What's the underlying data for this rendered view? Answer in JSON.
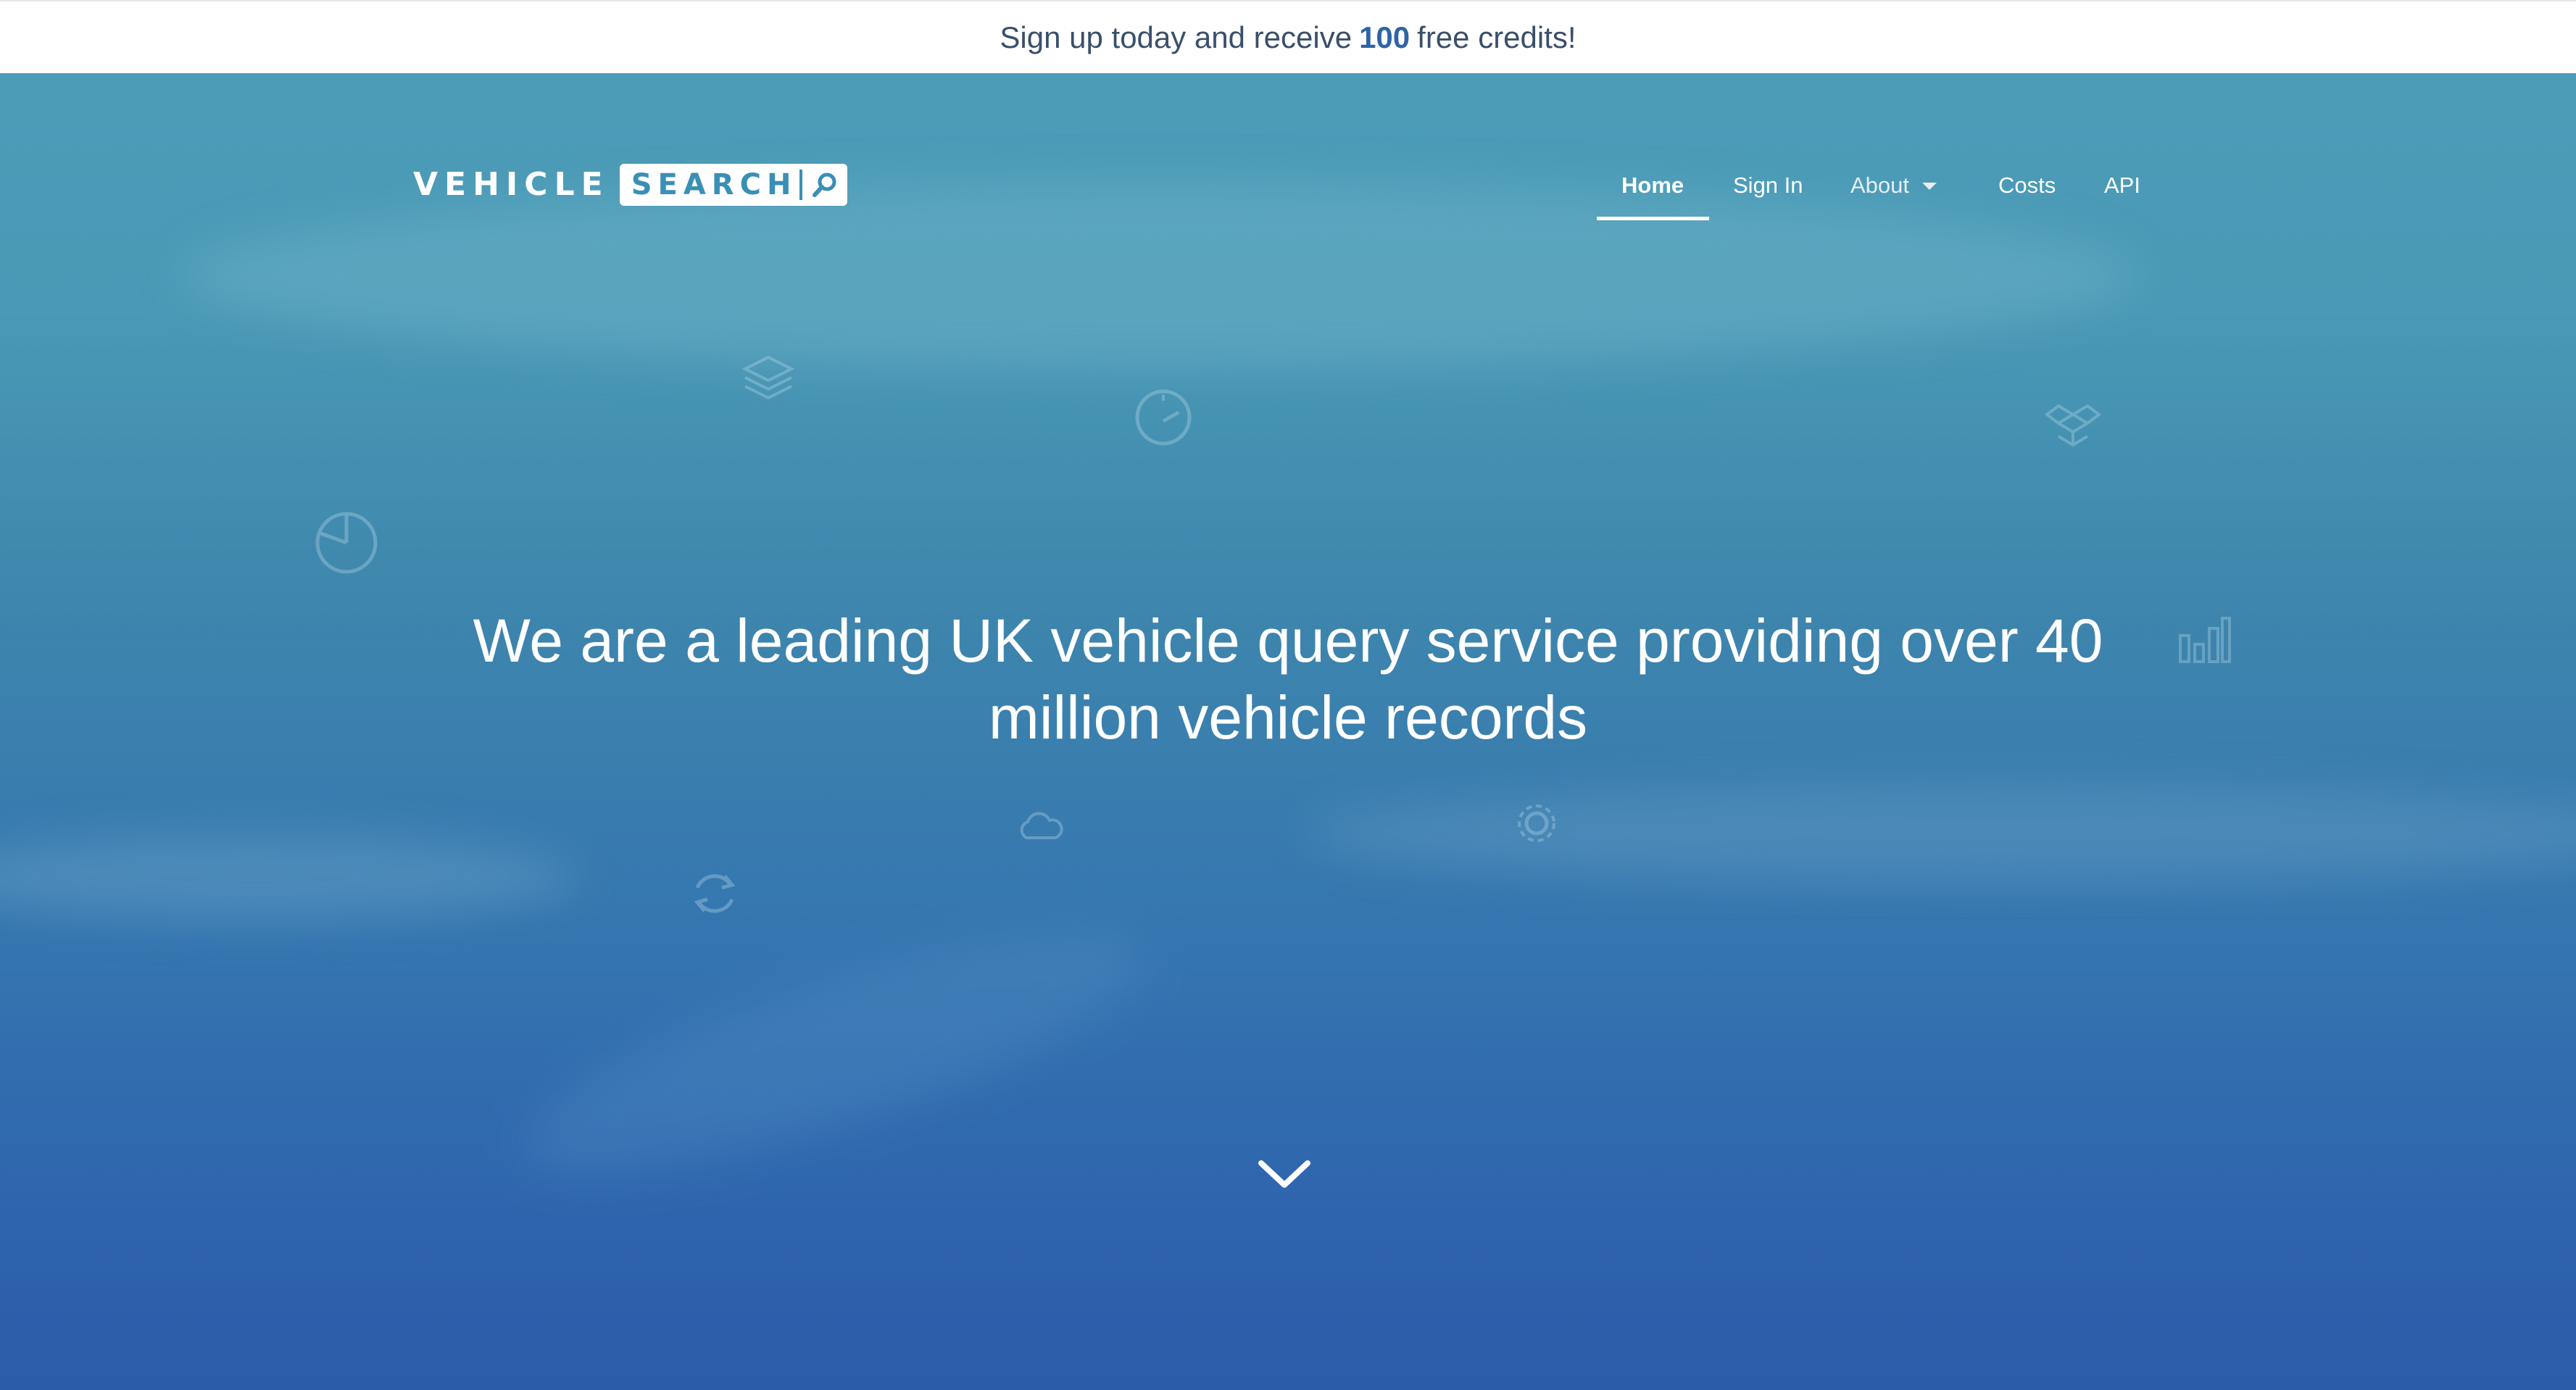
{
  "banner": {
    "text_before": "Sign up today and receive",
    "highlight": "100",
    "text_after": "free credits!"
  },
  "logo": {
    "word1": "VEHICLE",
    "word2": "SEARCH"
  },
  "nav": {
    "items": [
      {
        "label": "Home",
        "active": true
      },
      {
        "label": "Sign In"
      },
      {
        "label": "About",
        "has_dropdown": true
      },
      {
        "label": "Costs"
      },
      {
        "label": "API"
      }
    ]
  },
  "hero": {
    "headline": "We are a leading UK vehicle query service providing over 40 million vehicle records",
    "scroll_icon": "chevron-down-icon"
  },
  "colors": {
    "accent": "#2e64a6",
    "hero_top": "#4c9cb8",
    "hero_bottom": "#2b5ca9",
    "logo_box_text": "#3a8fb6"
  },
  "decorative_icons": [
    "layers-icon",
    "speedometer-icon",
    "dropbox-icon",
    "pie-chart-icon",
    "bar-chart-icon",
    "refresh-icon",
    "gear-icon",
    "cloud-icon"
  ]
}
